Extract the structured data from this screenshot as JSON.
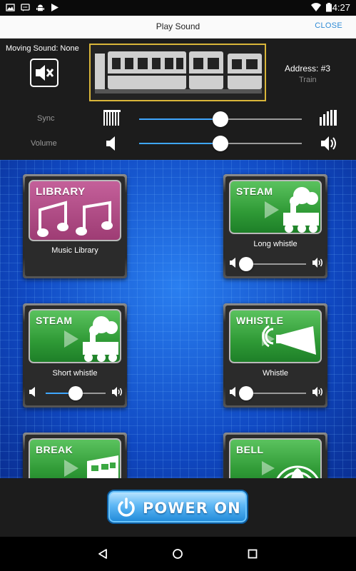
{
  "status_bar": {
    "time": "4:27"
  },
  "title_bar": {
    "title": "Play Sound",
    "close_label": "CLOSE"
  },
  "control": {
    "moving_sound": "Moving Sound: None",
    "address": "Address: #3",
    "address_type": "Train",
    "sync": {
      "label": "Sync",
      "level": 0.5
    },
    "volume": {
      "label": "Volume",
      "level": 0.5
    }
  },
  "tiles": [
    {
      "image_label": "LIBRARY",
      "caption": "Music Library",
      "style": "library",
      "has_slider": false
    },
    {
      "image_label": "STEAM",
      "caption": "Long whistle",
      "style": "steam",
      "has_slider": true,
      "level": 0.0
    },
    {
      "image_label": "STEAM",
      "caption": "Short whistle",
      "style": "steam",
      "has_slider": true,
      "level": 0.5
    },
    {
      "image_label": "WHISTLE",
      "caption": "Whistle",
      "style": "whistle",
      "has_slider": true,
      "level": 0.0
    },
    {
      "image_label": "BREAK",
      "caption": "",
      "style": "break",
      "has_slider": false
    },
    {
      "image_label": "BELL",
      "caption": "",
      "style": "bell",
      "has_slider": false
    }
  ],
  "power": {
    "label": "POWER ON"
  },
  "colors": {
    "accent": "#3fa7ff",
    "green": "#3aa841",
    "library": "#b04f87",
    "frame": "#d9b63a",
    "grid_blue": "#0d47b8"
  }
}
